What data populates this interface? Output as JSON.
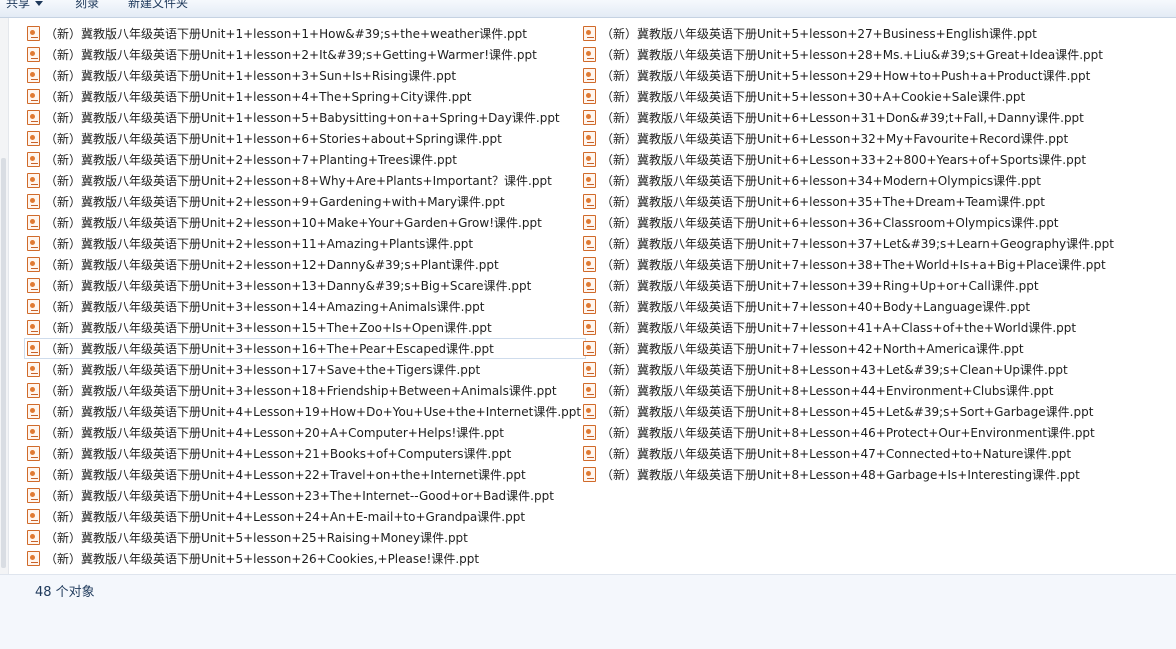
{
  "toolbar": {
    "share_label": "共享",
    "burn_label": "刻录",
    "new_folder_label": "新建文件夹"
  },
  "files_left": [
    "（新）冀教版八年级英语下册Unit+1+lesson+1+How&#39;s+the+weather课件.ppt",
    "（新）冀教版八年级英语下册Unit+1+lesson+2+It&#39;s+Getting+Warmer!课件.ppt",
    "（新）冀教版八年级英语下册Unit+1+lesson+3+Sun+Is+Rising课件.ppt",
    "（新）冀教版八年级英语下册Unit+1+lesson+4+The+Spring+City课件.ppt",
    "（新）冀教版八年级英语下册Unit+1+lesson+5+Babysitting+on+a+Spring+Day课件.ppt",
    "（新）冀教版八年级英语下册Unit+1+lesson+6+Stories+about+Spring课件.ppt",
    "（新）冀教版八年级英语下册Unit+2+lesson+7+Planting+Trees课件.ppt",
    "（新）冀教版八年级英语下册Unit+2+lesson+8+Why+Are+Plants+Important？课件.ppt",
    "（新）冀教版八年级英语下册Unit+2+lesson+9+Gardening+with+Mary课件.ppt",
    "（新）冀教版八年级英语下册Unit+2+lesson+10+Make+Your+Garden+Grow!课件.ppt",
    "（新）冀教版八年级英语下册Unit+2+lesson+11+Amazing+Plants课件.ppt",
    "（新）冀教版八年级英语下册Unit+2+lesson+12+Danny&#39;s+Plant课件.ppt",
    "（新）冀教版八年级英语下册Unit+3+lesson+13+Danny&#39;s+Big+Scare课件.ppt",
    "（新）冀教版八年级英语下册Unit+3+lesson+14+Amazing+Animals课件.ppt",
    "（新）冀教版八年级英语下册Unit+3+lesson+15+The+Zoo+Is+Open课件.ppt",
    "（新）冀教版八年级英语下册Unit+3+lesson+16+The+Pear+Escaped课件.ppt",
    "（新）冀教版八年级英语下册Unit+3+lesson+17+Save+the+Tigers课件.ppt",
    "（新）冀教版八年级英语下册Unit+3+lesson+18+Friendship+Between+Animals课件.ppt",
    "（新）冀教版八年级英语下册Unit+4+Lesson+19+How+Do+You+Use+the+Internet课件.ppt",
    "（新）冀教版八年级英语下册Unit+4+Lesson+20+A+Computer+Helps!课件.ppt",
    "（新）冀教版八年级英语下册Unit+4+Lesson+21+Books+of+Computers课件.ppt",
    "（新）冀教版八年级英语下册Unit+4+Lesson+22+Travel+on+the+Internet课件.ppt",
    "（新）冀教版八年级英语下册Unit+4+Lesson+23+The+Internet--Good+or+Bad课件.ppt",
    "（新）冀教版八年级英语下册Unit+4+Lesson+24+An+E-mail+to+Grandpa课件.ppt",
    "（新）冀教版八年级英语下册Unit+5+lesson+25+Raising+Money课件.ppt",
    "（新）冀教版八年级英语下册Unit+5+lesson+26+Cookies,+Please!课件.ppt"
  ],
  "files_right": [
    "（新）冀教版八年级英语下册Unit+5+lesson+27+Business+English课件.ppt",
    "（新）冀教版八年级英语下册Unit+5+lesson+28+Ms.+Liu&#39;s+Great+Idea课件.ppt",
    "（新）冀教版八年级英语下册Unit+5+lesson+29+How+to+Push+a+Product课件.ppt",
    "（新）冀教版八年级英语下册Unit+5+lesson+30+A+Cookie+Sale课件.ppt",
    "（新）冀教版八年级英语下册Unit+6+Lesson+31+Don&#39;t+Fall,+Danny课件.ppt",
    "（新）冀教版八年级英语下册Unit+6+Lesson+32+My+Favourite+Record课件.ppt",
    "（新）冀教版八年级英语下册Unit+6+Lesson+33+2+800+Years+of+Sports课件.ppt",
    "（新）冀教版八年级英语下册Unit+6+lesson+34+Modern+Olympics课件.ppt",
    "（新）冀教版八年级英语下册Unit+6+lesson+35+The+Dream+Team课件.ppt",
    "（新）冀教版八年级英语下册Unit+6+lesson+36+Classroom+Olympics课件.ppt",
    "（新）冀教版八年级英语下册Unit+7+lesson+37+Let&#39;s+Learn+Geography课件.ppt",
    "（新）冀教版八年级英语下册Unit+7+lesson+38+The+World+Is+a+Big+Place课件.ppt",
    "（新）冀教版八年级英语下册Unit+7+lesson+39+Ring+Up+or+Call课件.ppt",
    "（新）冀教版八年级英语下册Unit+7+lesson+40+Body+Language课件.ppt",
    "（新）冀教版八年级英语下册Unit+7+lesson+41+A+Class+of+the+World课件.ppt",
    "（新）冀教版八年级英语下册Unit+7+lesson+42+North+America课件.ppt",
    "（新）冀教版八年级英语下册Unit+8+Lesson+43+Let&#39;s+Clean+Up课件.ppt",
    "（新）冀教版八年级英语下册Unit+8+Lesson+44+Environment+Clubs课件.ppt",
    "（新）冀教版八年级英语下册Unit+8+Lesson+45+Let&#39;s+Sort+Garbage课件.ppt",
    "（新）冀教版八年级英语下册Unit+8+Lesson+46+Protect+Our+Environment课件.ppt",
    "（新）冀教版八年级英语下册Unit+8+Lesson+47+Connected+to+Nature课件.ppt",
    "（新）冀教版八年级英语下册Unit+8+Lesson+48+Garbage+Is+Interesting课件.ppt"
  ],
  "selected_file": "（新）冀教版八年级英语下册Unit+3+lesson+16+The+Pear+Escaped课件.ppt",
  "status": {
    "item_count": "48 个对象"
  },
  "icons": {
    "file_icon": "ppt-file-icon"
  }
}
